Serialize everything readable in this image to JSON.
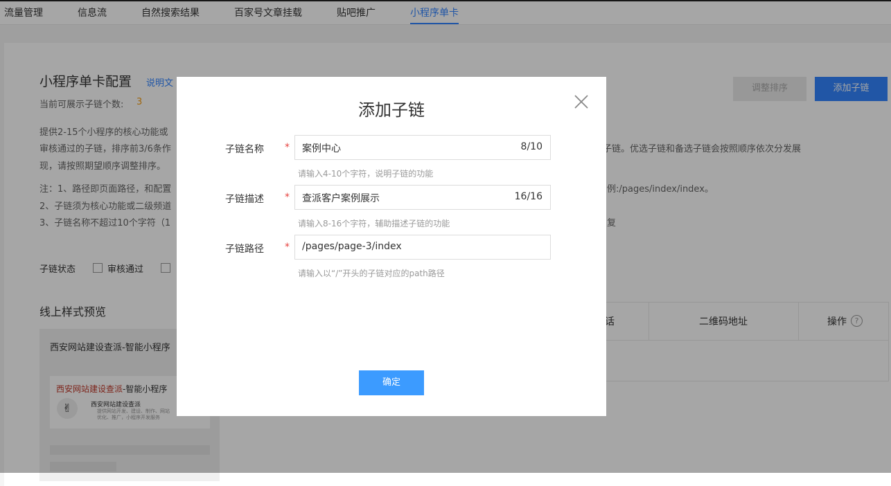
{
  "nav": {
    "tabs": [
      "流量管理",
      "信息流",
      "自然搜索结果",
      "百家号文章挂载",
      "贴吧推广",
      "小程序单卡"
    ],
    "active_index": 5
  },
  "page": {
    "title": "小程序单卡配置",
    "doc_link": "说明文",
    "count_label": "当前可展示子链个数:",
    "count_value": "3",
    "desc_line1": "提供2-15个小程序的核心功能或",
    "desc_line2": "审核通过的子链，排序前3/6条作",
    "desc_line2_right": "子链。优选子链和备选子链会按照顺序依次分发展",
    "desc_line3": "现，请按照期望顺序调整排序。",
    "note_line1": "注：1、路径即页面路径，和配置",
    "note_line1_right": "例:/pages/index/index。",
    "note_line2": "2、子链须为核心功能或二级频道",
    "note_line3": "3、子链名称不超过10个字符（1",
    "note_line3_right": "复",
    "buttons": {
      "reorder": "调整排序",
      "add": "添加子链"
    },
    "filter": {
      "label": "子链状态",
      "option1": "审核通过"
    },
    "preview": {
      "title": "线上样式预览",
      "card_title": "西安网站建设查派-智能小程序",
      "inner_title_red": "西安网站建设查派",
      "inner_title_rest": "-智能小程序",
      "inner_name": "西安网站建设查派",
      "inner_desc1": "提供网站开发、建设、制作、网站",
      "inner_desc2": "优化、推广，小程序开发服务"
    },
    "table": {
      "col_partial": "话",
      "col_qrcode": "二维码地址",
      "col_action": "操作"
    }
  },
  "modal": {
    "title": "添加子链",
    "fields": [
      {
        "label": "子链名称",
        "value": "案例中心",
        "count": "8/10",
        "hint": "请输入4-10个字符，说明子链的功能"
      },
      {
        "label": "子链描述",
        "value": "查派客户案例展示",
        "count": "16/16",
        "hint": "请输入8-16个字符，辅助描述子链的功能"
      },
      {
        "label": "子链路径",
        "value": "/pages/page-3/index",
        "count": "",
        "hint": "请输入以“/”开头的子链对应的path路径"
      }
    ],
    "required_mark": "*",
    "confirm": "确定"
  },
  "colors": {
    "accent": "#3385ff",
    "required": "#e64340",
    "count": "#f39c12"
  }
}
